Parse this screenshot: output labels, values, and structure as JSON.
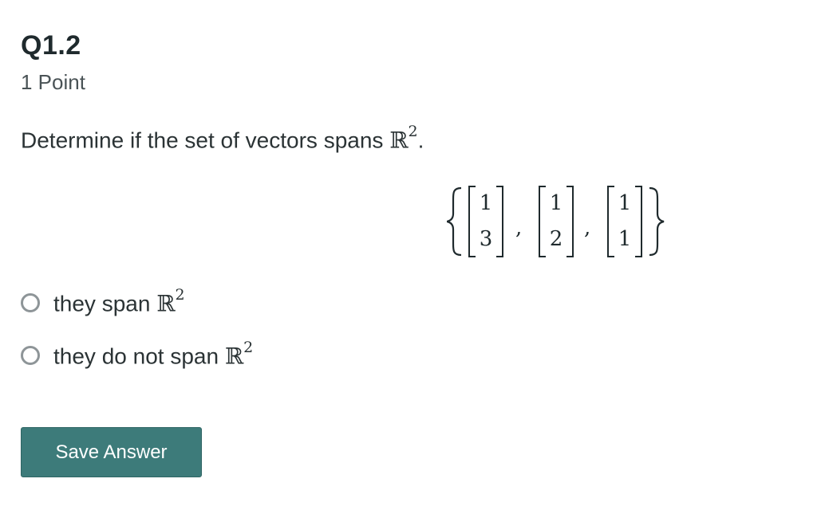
{
  "question": {
    "title": "Q1.2",
    "points": "1 Point",
    "prompt_text": "Determine if the set of vectors spans ",
    "prompt_space": "ℝ",
    "prompt_exponent": "2",
    "prompt_end": ".",
    "vectors": [
      [
        "1",
        "3"
      ],
      [
        "1",
        "2"
      ],
      [
        "1",
        "1"
      ]
    ]
  },
  "options": [
    {
      "text": "they span ",
      "space": "ℝ",
      "exponent": "2",
      "selected": false
    },
    {
      "text": "they do not span ",
      "space": "ℝ",
      "exponent": "2",
      "selected": false
    }
  ],
  "save_button": {
    "label": "Save Answer"
  },
  "colors": {
    "button_bg": "#3d7b7a",
    "text": "#2b3335",
    "radio_border": "#8e9598"
  }
}
